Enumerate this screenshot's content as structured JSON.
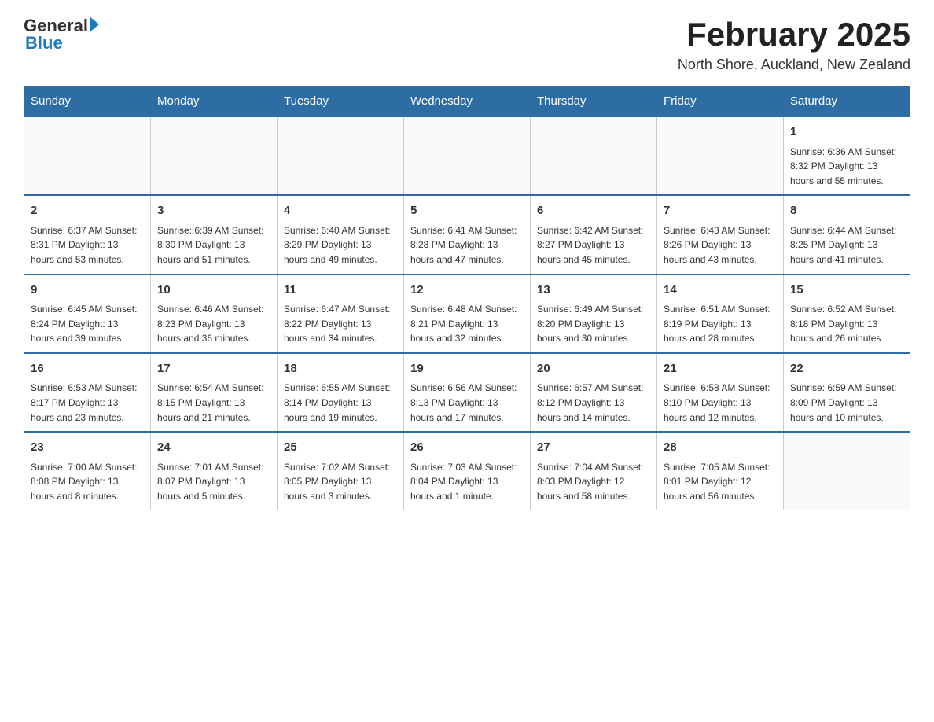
{
  "header": {
    "logo_general": "General",
    "logo_blue": "Blue",
    "title": "February 2025",
    "subtitle": "North Shore, Auckland, New Zealand"
  },
  "days_of_week": [
    "Sunday",
    "Monday",
    "Tuesday",
    "Wednesday",
    "Thursday",
    "Friday",
    "Saturday"
  ],
  "weeks": [
    [
      {
        "day": "",
        "info": ""
      },
      {
        "day": "",
        "info": ""
      },
      {
        "day": "",
        "info": ""
      },
      {
        "day": "",
        "info": ""
      },
      {
        "day": "",
        "info": ""
      },
      {
        "day": "",
        "info": ""
      },
      {
        "day": "1",
        "info": "Sunrise: 6:36 AM\nSunset: 8:32 PM\nDaylight: 13 hours and 55 minutes."
      }
    ],
    [
      {
        "day": "2",
        "info": "Sunrise: 6:37 AM\nSunset: 8:31 PM\nDaylight: 13 hours and 53 minutes."
      },
      {
        "day": "3",
        "info": "Sunrise: 6:39 AM\nSunset: 8:30 PM\nDaylight: 13 hours and 51 minutes."
      },
      {
        "day": "4",
        "info": "Sunrise: 6:40 AM\nSunset: 8:29 PM\nDaylight: 13 hours and 49 minutes."
      },
      {
        "day": "5",
        "info": "Sunrise: 6:41 AM\nSunset: 8:28 PM\nDaylight: 13 hours and 47 minutes."
      },
      {
        "day": "6",
        "info": "Sunrise: 6:42 AM\nSunset: 8:27 PM\nDaylight: 13 hours and 45 minutes."
      },
      {
        "day": "7",
        "info": "Sunrise: 6:43 AM\nSunset: 8:26 PM\nDaylight: 13 hours and 43 minutes."
      },
      {
        "day": "8",
        "info": "Sunrise: 6:44 AM\nSunset: 8:25 PM\nDaylight: 13 hours and 41 minutes."
      }
    ],
    [
      {
        "day": "9",
        "info": "Sunrise: 6:45 AM\nSunset: 8:24 PM\nDaylight: 13 hours and 39 minutes."
      },
      {
        "day": "10",
        "info": "Sunrise: 6:46 AM\nSunset: 8:23 PM\nDaylight: 13 hours and 36 minutes."
      },
      {
        "day": "11",
        "info": "Sunrise: 6:47 AM\nSunset: 8:22 PM\nDaylight: 13 hours and 34 minutes."
      },
      {
        "day": "12",
        "info": "Sunrise: 6:48 AM\nSunset: 8:21 PM\nDaylight: 13 hours and 32 minutes."
      },
      {
        "day": "13",
        "info": "Sunrise: 6:49 AM\nSunset: 8:20 PM\nDaylight: 13 hours and 30 minutes."
      },
      {
        "day": "14",
        "info": "Sunrise: 6:51 AM\nSunset: 8:19 PM\nDaylight: 13 hours and 28 minutes."
      },
      {
        "day": "15",
        "info": "Sunrise: 6:52 AM\nSunset: 8:18 PM\nDaylight: 13 hours and 26 minutes."
      }
    ],
    [
      {
        "day": "16",
        "info": "Sunrise: 6:53 AM\nSunset: 8:17 PM\nDaylight: 13 hours and 23 minutes."
      },
      {
        "day": "17",
        "info": "Sunrise: 6:54 AM\nSunset: 8:15 PM\nDaylight: 13 hours and 21 minutes."
      },
      {
        "day": "18",
        "info": "Sunrise: 6:55 AM\nSunset: 8:14 PM\nDaylight: 13 hours and 19 minutes."
      },
      {
        "day": "19",
        "info": "Sunrise: 6:56 AM\nSunset: 8:13 PM\nDaylight: 13 hours and 17 minutes."
      },
      {
        "day": "20",
        "info": "Sunrise: 6:57 AM\nSunset: 8:12 PM\nDaylight: 13 hours and 14 minutes."
      },
      {
        "day": "21",
        "info": "Sunrise: 6:58 AM\nSunset: 8:10 PM\nDaylight: 13 hours and 12 minutes."
      },
      {
        "day": "22",
        "info": "Sunrise: 6:59 AM\nSunset: 8:09 PM\nDaylight: 13 hours and 10 minutes."
      }
    ],
    [
      {
        "day": "23",
        "info": "Sunrise: 7:00 AM\nSunset: 8:08 PM\nDaylight: 13 hours and 8 minutes."
      },
      {
        "day": "24",
        "info": "Sunrise: 7:01 AM\nSunset: 8:07 PM\nDaylight: 13 hours and 5 minutes."
      },
      {
        "day": "25",
        "info": "Sunrise: 7:02 AM\nSunset: 8:05 PM\nDaylight: 13 hours and 3 minutes."
      },
      {
        "day": "26",
        "info": "Sunrise: 7:03 AM\nSunset: 8:04 PM\nDaylight: 13 hours and 1 minute."
      },
      {
        "day": "27",
        "info": "Sunrise: 7:04 AM\nSunset: 8:03 PM\nDaylight: 12 hours and 58 minutes."
      },
      {
        "day": "28",
        "info": "Sunrise: 7:05 AM\nSunset: 8:01 PM\nDaylight: 12 hours and 56 minutes."
      },
      {
        "day": "",
        "info": ""
      }
    ]
  ]
}
